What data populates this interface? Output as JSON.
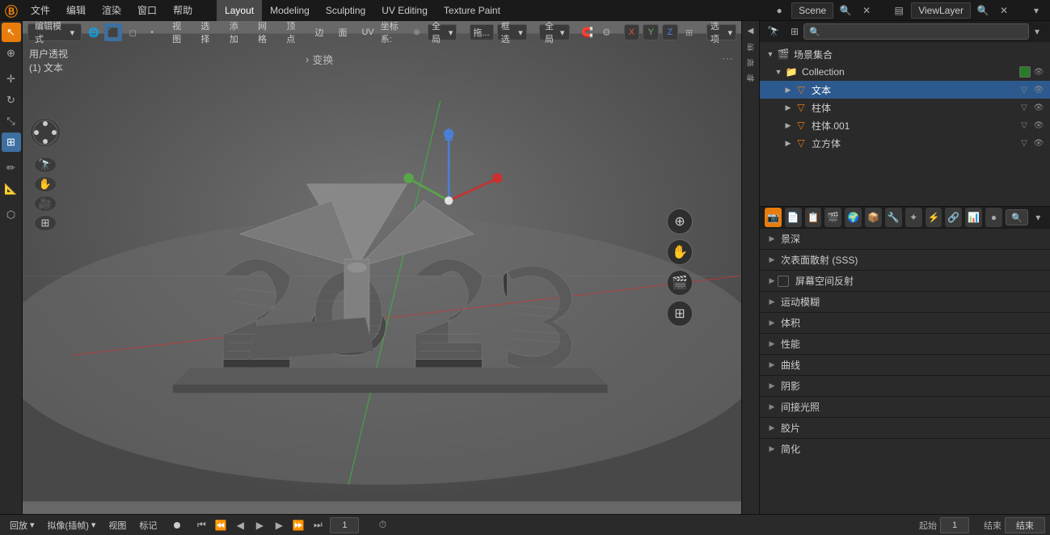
{
  "topbar": {
    "logo": "Ⓑ",
    "menus": [
      "文件",
      "编辑",
      "渲染",
      "窗口",
      "帮助"
    ],
    "workspace_tabs": [
      "Layout",
      "Modeling",
      "Sculpting",
      "UV Editing",
      "Texture Paint"
    ],
    "active_workspace": "Layout",
    "scene_label": "Scene",
    "view_layer": "ViewLayer"
  },
  "viewport": {
    "mode_label": "编辑模式",
    "view_label": "视图",
    "select_label": "选择",
    "add_label": "添加",
    "mesh_label": "网格",
    "vertex_label": "顶点",
    "edge_label": "边",
    "face_label": "面",
    "uv_label": "UV",
    "coord_system": "全局",
    "snap_label": "框选",
    "user_view_label": "用户透视",
    "object_label": "(1) 文本",
    "transform_label": "变换",
    "x_axis": "X",
    "y_axis": "Y",
    "z_axis": "Z",
    "options_label": "选项",
    "proportional_label": "选项"
  },
  "bottom_bar": {
    "playback_label": "回放",
    "insert_label": "拟像(插帧)",
    "view_label": "视图",
    "mark_label": "标记",
    "frame_current": "1",
    "start_label": "起始",
    "start_frame": "1",
    "end_label": "结束",
    "timeline_dot": "●"
  },
  "outliner": {
    "scene_collection": "场景集合",
    "collection": "Collection",
    "items": [
      {
        "name": "文本",
        "type": "text",
        "selected": true,
        "icon": "▽"
      },
      {
        "name": "柱体",
        "type": "mesh",
        "selected": false,
        "icon": "▽"
      },
      {
        "name": "柱体.001",
        "type": "mesh",
        "selected": false,
        "icon": "▽"
      },
      {
        "name": "立方体",
        "type": "mesh",
        "selected": false,
        "icon": "▽"
      }
    ]
  },
  "properties": {
    "sections": [
      {
        "label": "景深",
        "expanded": false
      },
      {
        "label": "次表面散射 (SSS)",
        "expanded": false
      },
      {
        "label": "屏幕空间反射",
        "expanded": false,
        "has_checkbox": true
      },
      {
        "label": "运动模糊",
        "expanded": false
      },
      {
        "label": "体积",
        "expanded": false
      },
      {
        "label": "性能",
        "expanded": false
      },
      {
        "label": "曲线",
        "expanded": false
      },
      {
        "label": "阴影",
        "expanded": false
      },
      {
        "label": "间接光照",
        "expanded": false
      },
      {
        "label": "胶片",
        "expanded": false
      },
      {
        "label": "简化",
        "expanded": false
      }
    ]
  },
  "tools": {
    "left_tools": [
      {
        "icon": "↗",
        "label": "select",
        "active": true
      },
      {
        "icon": "⊕",
        "label": "cursor",
        "active": false
      },
      {
        "icon": "✥",
        "label": "move",
        "active": false
      },
      {
        "icon": "↺",
        "label": "rotate",
        "active": false
      },
      {
        "icon": "⤡",
        "label": "scale",
        "active": false
      },
      {
        "icon": "⊡",
        "label": "transform",
        "active": false,
        "active_blue": true
      },
      {
        "icon": "✏",
        "label": "annotate",
        "active": false
      },
      {
        "icon": "📏",
        "label": "measure",
        "active": false
      },
      {
        "icon": "⬡",
        "label": "add-cube",
        "active": false
      }
    ]
  }
}
